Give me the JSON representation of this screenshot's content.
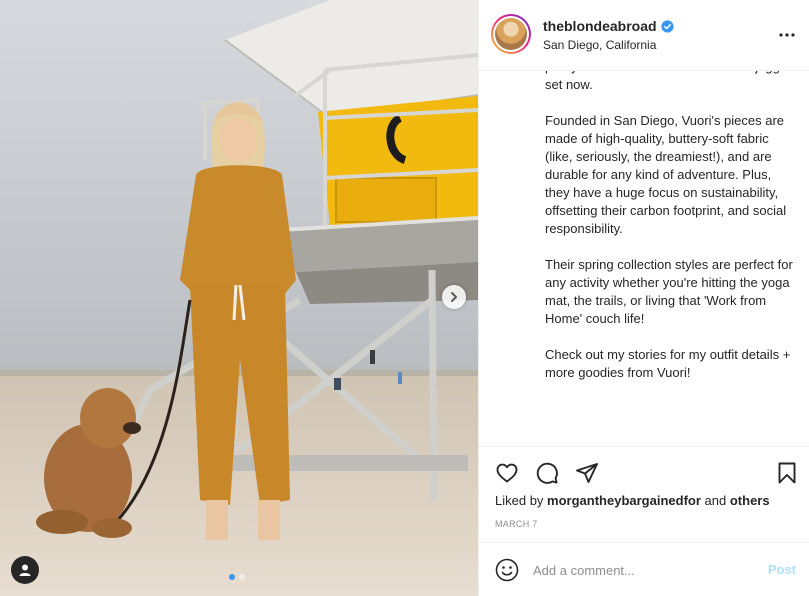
{
  "post": {
    "author": "theblondeabroad",
    "location": "San Diego, California",
    "caption_paragraphs": [
      "pretty much live in this Flax Heather jogger set now.",
      "Founded in San Diego, Vuori's pieces are made of high-quality, buttery-soft fabric (like, seriously, the dreamiest!), and are durable for any kind of adventure. Plus, they have a huge focus on sustainability, offsetting their carbon footprint, and social responsibility.",
      "Their spring collection styles are perfect for any activity whether you're hitting the yoga mat, the trails, or living that 'Work from Home' couch life!",
      "Check out my stories for my outfit details + more goodies from Vuori!"
    ],
    "likes": {
      "prefix": "Liked by",
      "user": "morgantheybargainedfor",
      "connector": "and",
      "others": "others"
    },
    "date": "MARCH 7"
  },
  "comment": {
    "placeholder": "Add a comment...",
    "post_label": "Post"
  },
  "carousel": {
    "count": 2,
    "active_index": 0
  },
  "icons": {
    "verified": "verified-badge-icon",
    "more": "more-options-icon",
    "like": "heart-icon",
    "comment": "comment-icon",
    "share": "paper-plane-icon",
    "save": "bookmark-icon",
    "emoji": "emoji-icon",
    "next": "chevron-right-icon",
    "tags": "user-tag-icon"
  },
  "colors": {
    "accent": "#3897f0",
    "verified": "#3897f0",
    "post_disabled": "#b2dffc",
    "muted": "#8e8e8e"
  }
}
